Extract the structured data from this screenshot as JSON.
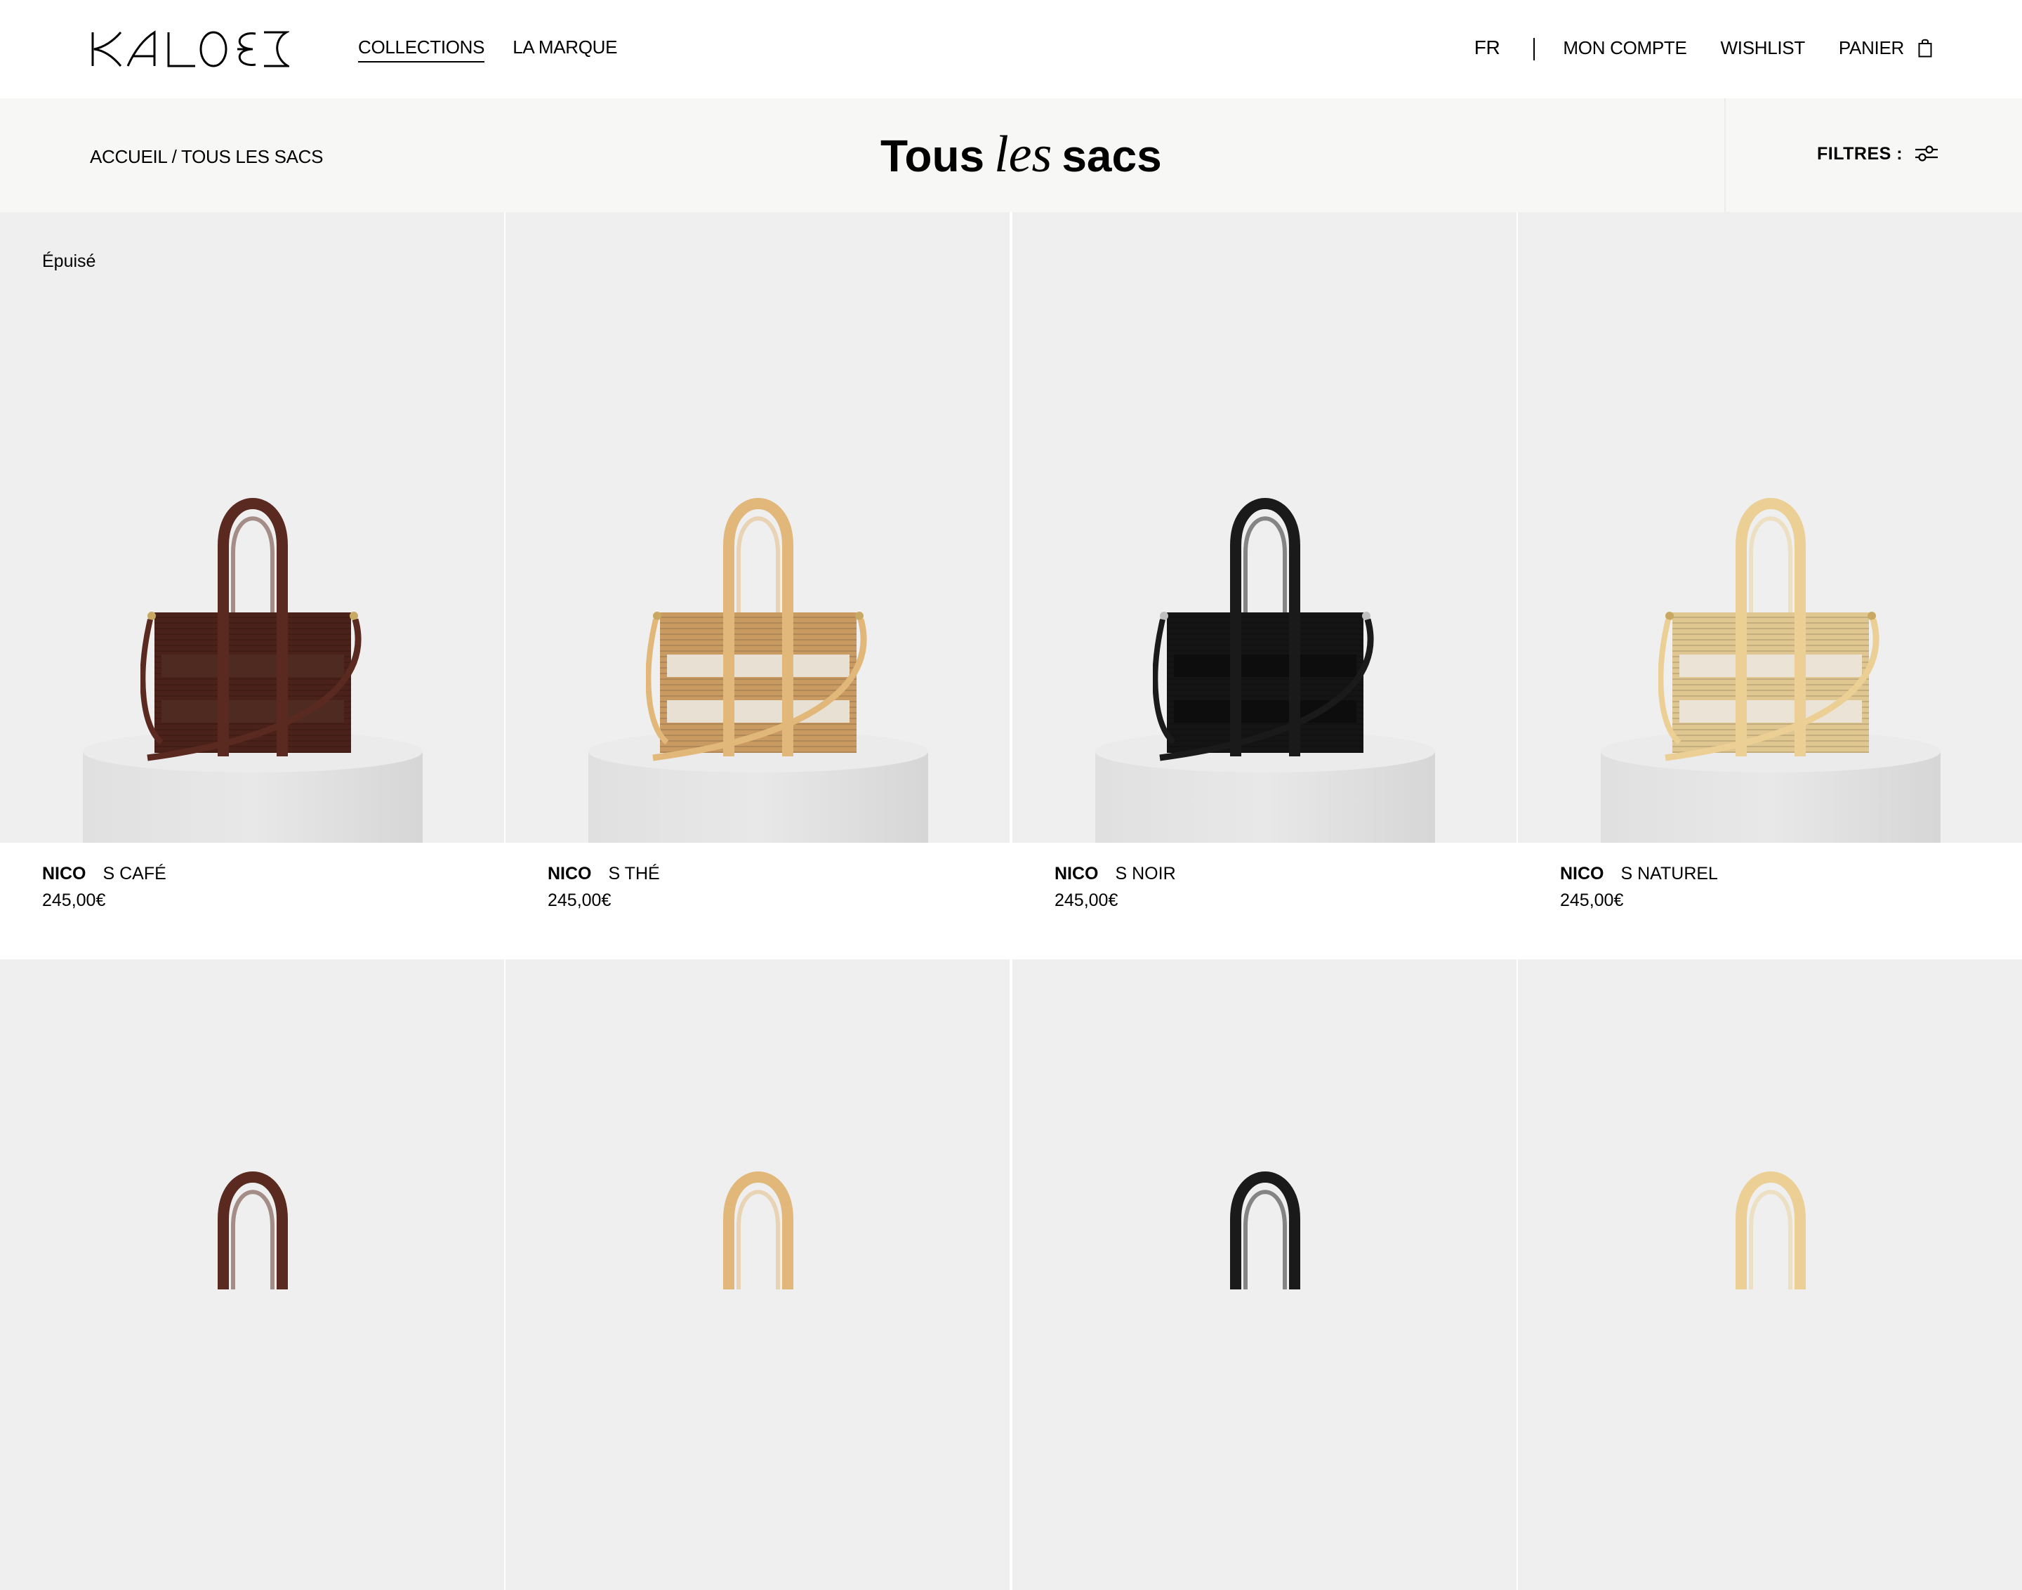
{
  "header": {
    "brand": "KALOES",
    "nav_left": [
      {
        "label": "COLLECTIONS",
        "active": true
      },
      {
        "label": "LA MARQUE",
        "active": false
      }
    ],
    "language": "FR",
    "nav_right": {
      "account": "MON COMPTE",
      "wishlist": "WISHLIST",
      "cart": "PANIER"
    },
    "icons": {
      "cart": "shopping-bag-icon"
    }
  },
  "titlebar": {
    "breadcrumb": {
      "home": "ACCUEIL",
      "separator": " / ",
      "current": "TOUS LES SACS"
    },
    "title": {
      "part1": "Tous",
      "part2": "les",
      "part3": "sacs"
    },
    "filters_label": "FILTRES :",
    "filters_icon": "sliders-icon"
  },
  "products": [
    {
      "model": "NICO",
      "variant": "S CAFÉ",
      "price": "245,00€",
      "badge": "Épuisé",
      "colors": {
        "leather": "#5a2a20",
        "weave": "#4a2219",
        "lining": "#4e2a20",
        "hardware": "#c8a862"
      }
    },
    {
      "model": "NICO",
      "variant": "S THÉ",
      "price": "245,00€",
      "badge": "",
      "colors": {
        "leather": "#e2b77a",
        "weave": "#c99a62",
        "lining": "#e8e1d3",
        "hardware": "#c8a862"
      }
    },
    {
      "model": "NICO",
      "variant": "S NOIR",
      "price": "245,00€",
      "badge": "",
      "colors": {
        "leather": "#1a1a1a",
        "weave": "#141414",
        "lining": "#0d0d0d",
        "hardware": "#bfbfbf"
      }
    },
    {
      "model": "NICO",
      "variant": "S NATUREL",
      "price": "245,00€",
      "badge": "",
      "colors": {
        "leather": "#eccf94",
        "weave": "#e0c690",
        "lining": "#ebe4d6",
        "hardware": "#c8a862"
      }
    }
  ],
  "products_row2": [
    {
      "colors": {
        "leather": "#5a2a20"
      }
    },
    {
      "colors": {
        "leather": "#e2b77a"
      }
    },
    {
      "colors": {
        "leather": "#1a1a1a"
      }
    },
    {
      "colors": {
        "leather": "#eccf94"
      }
    }
  ]
}
